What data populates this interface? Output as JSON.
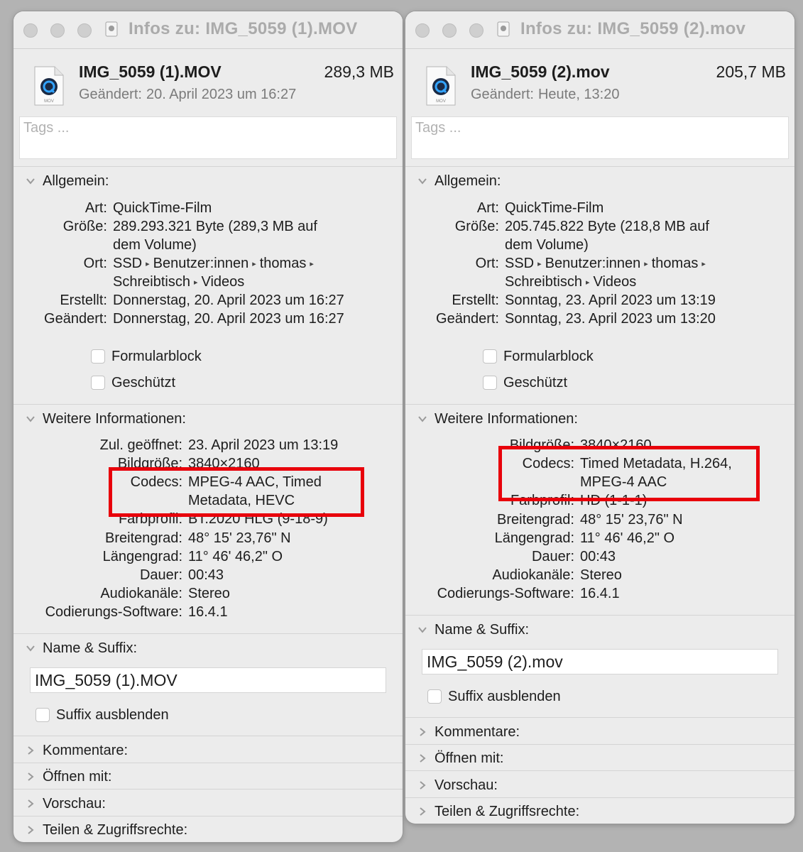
{
  "left": {
    "title": "Infos zu: IMG_5059 (1).MOV",
    "file_name": "IMG_5059 (1).MOV",
    "file_size": "289,3 MB",
    "modified_label": "Geändert:",
    "modified_value": "20. April 2023 um 16:27",
    "tags_placeholder": "Tags ...",
    "general": {
      "header": "Allgemein:",
      "art_label": "Art:",
      "art_value": "QuickTime-Film",
      "size_label": "Größe:",
      "size_value_1": "289.293.321 Byte (289,3 MB auf",
      "size_value_2": "dem Volume)",
      "ort_label": "Ort:",
      "ort_1": "SSD",
      "ort_2": "Benutzer:innen",
      "ort_3": "thomas",
      "ort_4": "Schreibtisch",
      "ort_5": "Videos",
      "created_label": "Erstellt:",
      "created_value": "Donnerstag, 20. April 2023 um 16:27",
      "changed_label": "Geändert:",
      "changed_value": "Donnerstag, 20. April 2023 um 16:27",
      "formularblock": "Formularblock",
      "geschuetzt": "Geschützt"
    },
    "more": {
      "header": "Weitere Informationen:",
      "opened_label": "Zul. geöffnet:",
      "opened_value": "23. April 2023 um 13:19",
      "bild_label": "Bildgröße:",
      "bild_value": "3840×2160",
      "codecs_label": "Codecs:",
      "codecs_1": "MPEG-4 AAC, Timed",
      "codecs_2": "Metadata, HEVC",
      "farb_label": "Farbprofil:",
      "farb_value": "BT.2020 HLG (9-18-9)",
      "breite_label": "Breitengrad:",
      "breite_value": "48° 15' 23,76\" N",
      "laenge_label": "Längengrad:",
      "laenge_value": "11° 46' 46,2\" O",
      "dauer_label": "Dauer:",
      "dauer_value": "00:43",
      "audio_label": "Audiokanäle:",
      "audio_value": "Stereo",
      "soft_label": "Codierungs-Software:",
      "soft_value": "16.4.1"
    },
    "name_suffix": {
      "header": "Name & Suffix:",
      "value": "IMG_5059 (1).MOV",
      "hide_suffix": "Suffix ausblenden"
    },
    "collapsed": [
      "Kommentare:",
      "Öffnen mit:",
      "Vorschau:",
      "Teilen & Zugriffsrechte:"
    ]
  },
  "right": {
    "title": "Infos zu: IMG_5059 (2).mov",
    "file_name": "IMG_5059 (2).mov",
    "file_size": "205,7 MB",
    "modified_label": "Geändert:",
    "modified_value": "Heute, 13:20",
    "tags_placeholder": "Tags ...",
    "general": {
      "header": "Allgemein:",
      "art_label": "Art:",
      "art_value": "QuickTime-Film",
      "size_label": "Größe:",
      "size_value_1": "205.745.822 Byte (218,8 MB auf",
      "size_value_2": "dem Volume)",
      "ort_label": "Ort:",
      "ort_1": "SSD",
      "ort_2": "Benutzer:innen",
      "ort_3": "thomas",
      "ort_4": "Schreibtisch",
      "ort_5": "Videos",
      "created_label": "Erstellt:",
      "created_value": "Sonntag, 23. April 2023 um 13:19",
      "changed_label": "Geändert:",
      "changed_value": "Sonntag, 23. April 2023 um 13:20",
      "formularblock": "Formularblock",
      "geschuetzt": "Geschützt"
    },
    "more": {
      "header": "Weitere Informationen:",
      "bild_label": "Bildgröße:",
      "bild_value": "3840×2160",
      "codecs_label": "Codecs:",
      "codecs_1": "Timed Metadata, H.264,",
      "codecs_2": "MPEG-4 AAC",
      "farb_label": "Farbprofil:",
      "farb_value": "HD (1-1-1)",
      "breite_label": "Breitengrad:",
      "breite_value": "48° 15' 23,76\" N",
      "laenge_label": "Längengrad:",
      "laenge_value": "11° 46' 46,2\" O",
      "dauer_label": "Dauer:",
      "dauer_value": "00:43",
      "audio_label": "Audiokanäle:",
      "audio_value": "Stereo",
      "soft_label": "Codierungs-Software:",
      "soft_value": "16.4.1"
    },
    "name_suffix": {
      "header": "Name & Suffix:",
      "value": "IMG_5059 (2).mov",
      "hide_suffix": "Suffix ausblenden"
    },
    "collapsed": [
      "Kommentare:",
      "Öffnen mit:",
      "Vorschau:",
      "Teilen & Zugriffsrechte:"
    ]
  },
  "colors": {
    "highlight": "#e8000b",
    "window_bg": "#ececec"
  },
  "icons": {
    "expanded": "chevron-down-icon",
    "collapsed": "chevron-right-icon",
    "file": "mov-file-icon",
    "path_separator": "path-arrow-icon"
  }
}
